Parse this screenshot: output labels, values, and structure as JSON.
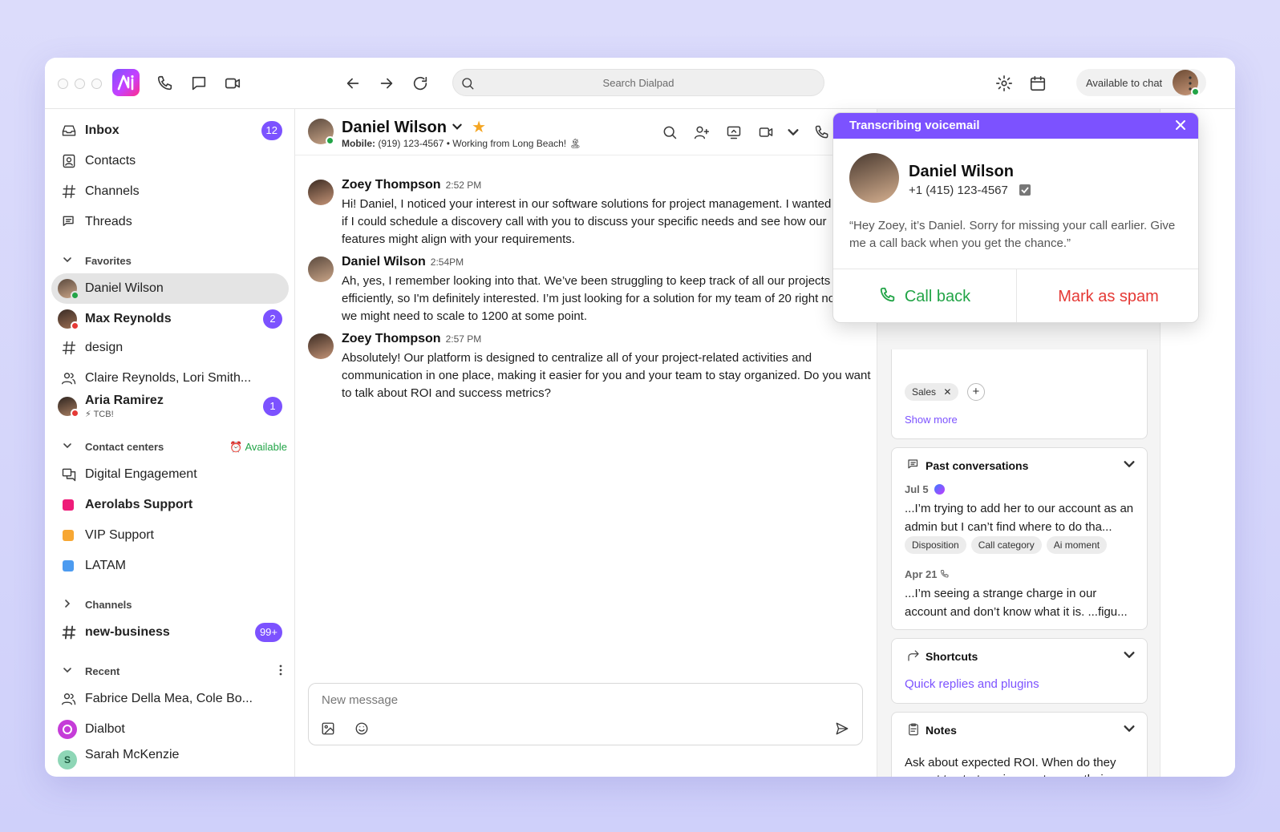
{
  "colors": {
    "accent": "#7c52ff",
    "online": "#22a447",
    "busy": "#e53935",
    "spam": "#e53935",
    "star": "#f5a623"
  },
  "topbar": {
    "search_placeholder": "Search Dialpad",
    "status": "Available to chat"
  },
  "sidebar": {
    "nav": [
      {
        "label": "Inbox",
        "badge": "12",
        "icon": "inbox-icon"
      },
      {
        "label": "Contacts",
        "icon": "contacts-icon"
      },
      {
        "label": "Channels",
        "icon": "hash-icon"
      },
      {
        "label": "Threads",
        "icon": "threads-icon"
      }
    ],
    "favorites_label": "Favorites",
    "favorites": [
      {
        "label": "Daniel Wilson"
      },
      {
        "label": "Max Reynolds",
        "badge": "2"
      },
      {
        "label": "design"
      },
      {
        "label": "Claire Reynolds, Lori Smith..."
      },
      {
        "label": "Aria Ramirez",
        "sub": "⚡ TCB!",
        "badge": "1"
      }
    ],
    "contact_centers_label": "Contact centers",
    "contact_centers_status": "Available",
    "contact_centers": [
      {
        "label": "Digital Engagement"
      },
      {
        "label": "Aerolabs Support",
        "color": "#ee1c79"
      },
      {
        "label": "VIP Support",
        "color": "#f7a733"
      },
      {
        "label": "LATAM",
        "color": "#4c9bf0"
      }
    ],
    "channels_label": "Channels",
    "channels": [
      {
        "label": "new-business",
        "badge": "99+"
      }
    ],
    "recent_label": "Recent",
    "recent": [
      {
        "label": "Fabrice Della Mea, Cole Bo..."
      },
      {
        "label": "Dialbot"
      },
      {
        "label": "Sarah McKenzie"
      }
    ]
  },
  "conversation": {
    "name": "Daniel Wilson",
    "sub_label": "Mobile:",
    "sub_value": "(919) 123-4567 • Working from Long Beach! 🏝",
    "messages": [
      {
        "name": "Zoey Thompson",
        "time": "2:52 PM",
        "text": "Hi! Daniel, I noticed your interest in our software solutions for project management. I wanted to see if I could schedule a discovery call with you to discuss your specific needs and see how our features might align with your requirements."
      },
      {
        "name": "Daniel Wilson",
        "time": "2:54PM",
        "text": "Ah, yes, I remember looking into that. We’ve been struggling to keep track of all our projects efficiently, so I'm definitely interested. I’m just looking for a solution for my team of 20 right now, but we might need to scale to 1200 at some point."
      },
      {
        "name": "Zoey Thompson",
        "time": "2:57 PM",
        "text": "Absolutely! Our platform is designed to centralize all of your project-related activities and communication in one place, making it easier for you and your team to stay organized. Do you want to talk about ROI and success metrics?"
      }
    ],
    "composer_placeholder": "New message"
  },
  "right_panel": {
    "tags": [
      "Sales"
    ],
    "show_more": "Show more",
    "past": {
      "title": "Past conversations",
      "items": [
        {
          "date": "Jul 5",
          "text": "...I’m trying to add her to our account as an admin but I can’t find where to do tha...",
          "tags": [
            "Disposition",
            "Call category",
            "Ai moment"
          ]
        },
        {
          "date": "Apr 21",
          "text": "...I’m seeing a strange charge in our account and don’t know what it is. ...figu..."
        }
      ]
    },
    "shortcuts": {
      "title": "Shortcuts",
      "link": "Quick replies and plugins"
    },
    "notes": {
      "title": "Notes",
      "text": "Ask about expected ROI. When do they expect to start seeing a return on their investment?"
    }
  },
  "voicemail": {
    "title": "Transcribing voicemail",
    "name": "Daniel Wilson",
    "phone": "+1 (415) 123-4567",
    "quote": "“Hey Zoey, it’s Daniel. Sorry for missing your call earlier. Give me a call back when you get the chance.”",
    "call_back": "Call back",
    "mark_spam": "Mark as spam"
  }
}
